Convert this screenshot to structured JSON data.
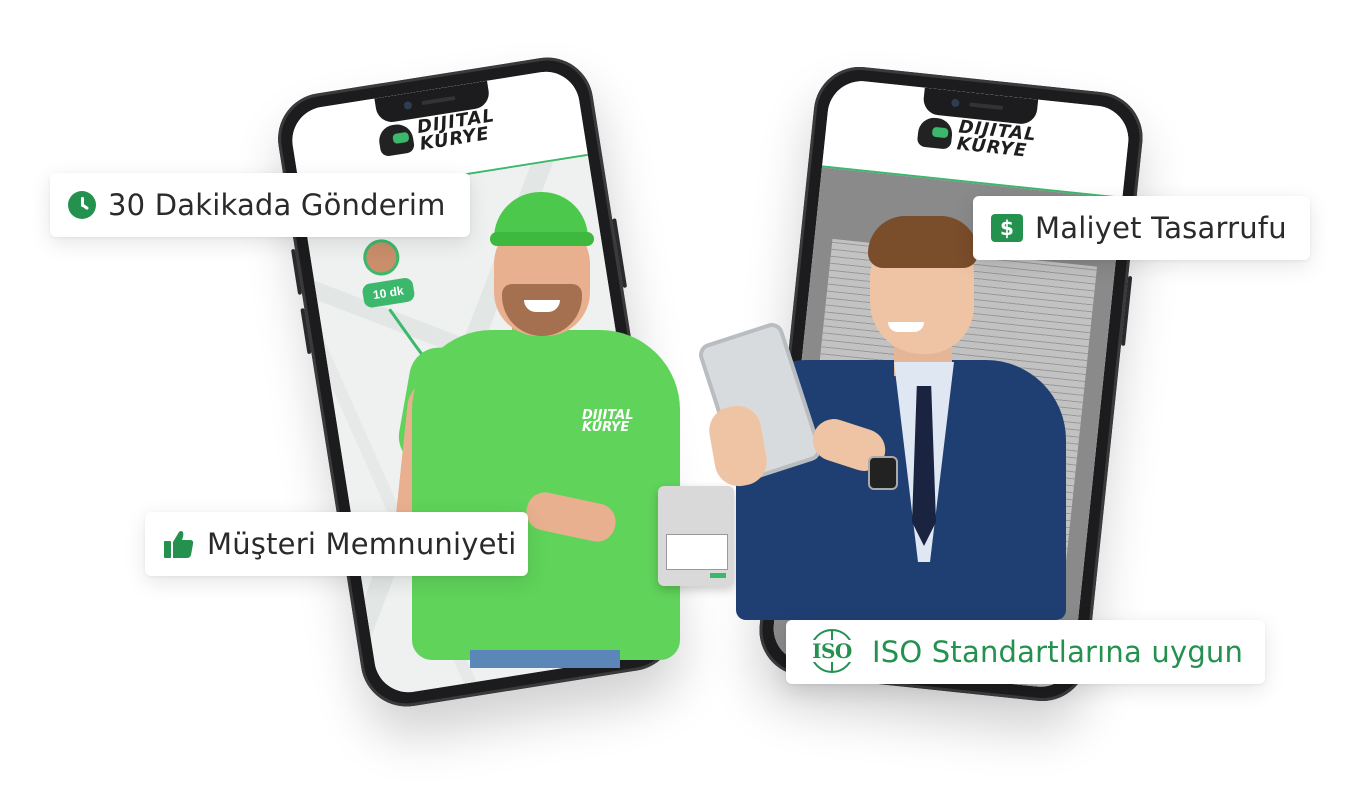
{
  "badges": {
    "delivery": {
      "icon": "clock-icon",
      "label": "30 Dakikada Gönderim"
    },
    "savings": {
      "icon": "dollar-icon",
      "symbol": "$",
      "label": "Maliyet Tasarrufu"
    },
    "satisfaction": {
      "icon": "thumbs-up-icon",
      "label": "Müşteri Memnuniyeti"
    },
    "iso": {
      "icon": "iso-globe-icon",
      "symbol": "ISO",
      "label": "ISO Standartlarına uygun"
    }
  },
  "phones": {
    "left": {
      "brand_line1": "DIJITAL",
      "brand_line2": "KURYE",
      "eta": "10 dk"
    },
    "right": {
      "brand_line1": "DIJITAL",
      "brand_line2": "KURYE"
    }
  },
  "courier": {
    "shirt_line1": "DIJITAL",
    "shirt_line2": "KURYE"
  },
  "colors": {
    "brand_green": "#24914f",
    "shirt_green": "#5fd35a",
    "route_green": "#3bb86b",
    "suit_blue": "#1f3f73"
  }
}
